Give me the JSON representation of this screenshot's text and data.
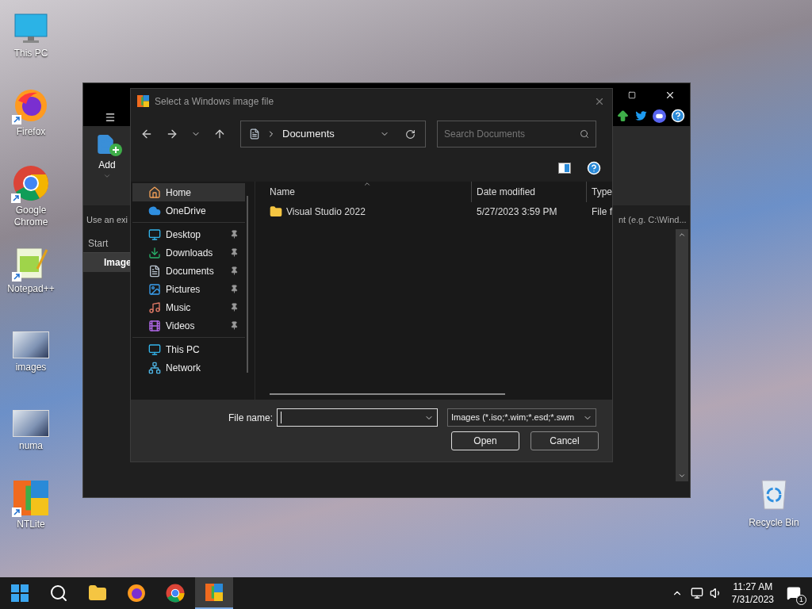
{
  "desktop_icons": [
    {
      "label": "This PC",
      "kind": "pc",
      "shortcut": false
    },
    {
      "label": "Firefox",
      "kind": "firefox",
      "shortcut": true
    },
    {
      "label": "Google Chrome",
      "kind": "chrome",
      "shortcut": true
    },
    {
      "label": "Notepad++",
      "kind": "notepad",
      "shortcut": true
    },
    {
      "label": "images",
      "kind": "photo",
      "shortcut": false
    },
    {
      "label": "numa",
      "kind": "photo",
      "shortcut": false
    },
    {
      "label": "NTLite",
      "kind": "ntlite",
      "shortcut": true
    }
  ],
  "recycle_bin": {
    "label": "Recycle Bin"
  },
  "app_window": {
    "add_button": "Add",
    "hint_text": "Use an exi",
    "column_header": "Start",
    "row_label": "Image",
    "path_hint": "nt (e.g. C:\\Wind..."
  },
  "dialog": {
    "title": "Select a Windows image file",
    "breadcrumb": "Documents",
    "search": {
      "placeholder": "Search Documents"
    },
    "nav_sections": [
      {
        "items": [
          {
            "label": "Home",
            "kind": "home",
            "pinned": false,
            "selected": true
          },
          {
            "label": "OneDrive",
            "kind": "cloud",
            "pinned": false,
            "selected": false
          }
        ]
      },
      {
        "items": [
          {
            "label": "Desktop",
            "kind": "desktop",
            "pinned": true,
            "selected": false
          },
          {
            "label": "Downloads",
            "kind": "download",
            "pinned": true,
            "selected": false
          },
          {
            "label": "Documents",
            "kind": "document",
            "pinned": true,
            "selected": false
          },
          {
            "label": "Pictures",
            "kind": "picture",
            "pinned": true,
            "selected": false
          },
          {
            "label": "Music",
            "kind": "music",
            "pinned": true,
            "selected": false
          },
          {
            "label": "Videos",
            "kind": "video",
            "pinned": true,
            "selected": false
          }
        ]
      },
      {
        "items": [
          {
            "label": "This PC",
            "kind": "pc",
            "pinned": false,
            "selected": false
          },
          {
            "label": "Network",
            "kind": "network",
            "pinned": false,
            "selected": false
          }
        ]
      }
    ],
    "columns": [
      "Name",
      "Date modified",
      "Type"
    ],
    "rows": [
      {
        "name": "Visual Studio 2022",
        "date": "5/27/2023 3:59 PM",
        "type": "File f"
      }
    ],
    "file_name": {
      "label": "File name:"
    },
    "file_type": "Images (*.iso;*.wim;*.esd;*.swm",
    "buttons": [
      "Open",
      "Cancel"
    ]
  },
  "taskbar": {
    "apps": [
      {
        "kind": "start",
        "selected": false
      },
      {
        "kind": "search",
        "selected": false
      },
      {
        "kind": "explorer",
        "selected": false
      },
      {
        "kind": "firefox",
        "selected": false
      },
      {
        "kind": "chrome",
        "selected": false
      },
      {
        "kind": "ntlite",
        "selected": true
      }
    ],
    "time": "11:27 AM",
    "date": "7/31/2023",
    "notification_count": "1"
  }
}
